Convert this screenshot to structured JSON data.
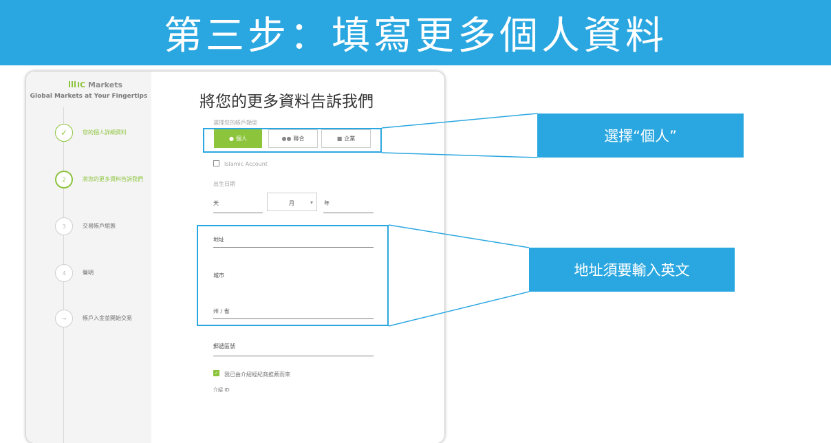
{
  "banner": {
    "title": "第三步：填寫更多個人資料"
  },
  "sidebar": {
    "logo_brand": "IC",
    "logo_suffix": "Markets",
    "tagline": "Global Markets at Your Fingertips",
    "steps": [
      {
        "number": "✓",
        "label": "您的個人詳細資料",
        "state": "done"
      },
      {
        "number": "2",
        "label": "將您的更多資料告訴我們",
        "state": "active"
      },
      {
        "number": "3",
        "label": "交易帳戶組態",
        "state": "pending"
      },
      {
        "number": "4",
        "label": "聲明",
        "state": "pending"
      },
      {
        "number": "→",
        "label": "帳戶入金並開始交易",
        "state": "pending"
      }
    ]
  },
  "form": {
    "title": "將您的更多資料告訴我們",
    "account_type_label": "選擇您的帳戶類型",
    "account_types": [
      {
        "label": "個人",
        "icon": "person-icon",
        "selected": true
      },
      {
        "label": "聯合",
        "icon": "people-icon",
        "selected": false
      },
      {
        "label": "企業",
        "icon": "briefcase-icon",
        "selected": false
      }
    ],
    "islamic_label": "Islamic Account",
    "dob_label": "出生日期",
    "dob_day_placeholder": "天",
    "dob_month_placeholder": "月",
    "dob_year_placeholder": "年",
    "address_label": "地址",
    "city_label": "城市",
    "state_label": "州 / 省",
    "postcode_label": "郵遞區號",
    "introducer_checkbox_label": "我已由介紹經紀商推薦而來",
    "introducer_id_label": "介紹 ID"
  },
  "callouts": {
    "select_individual": "選擇“個人”",
    "address_english": "地址須要輸入英文"
  },
  "colors": {
    "accent_blue": "#2aa7e0",
    "brand_green": "#8cc43c"
  }
}
